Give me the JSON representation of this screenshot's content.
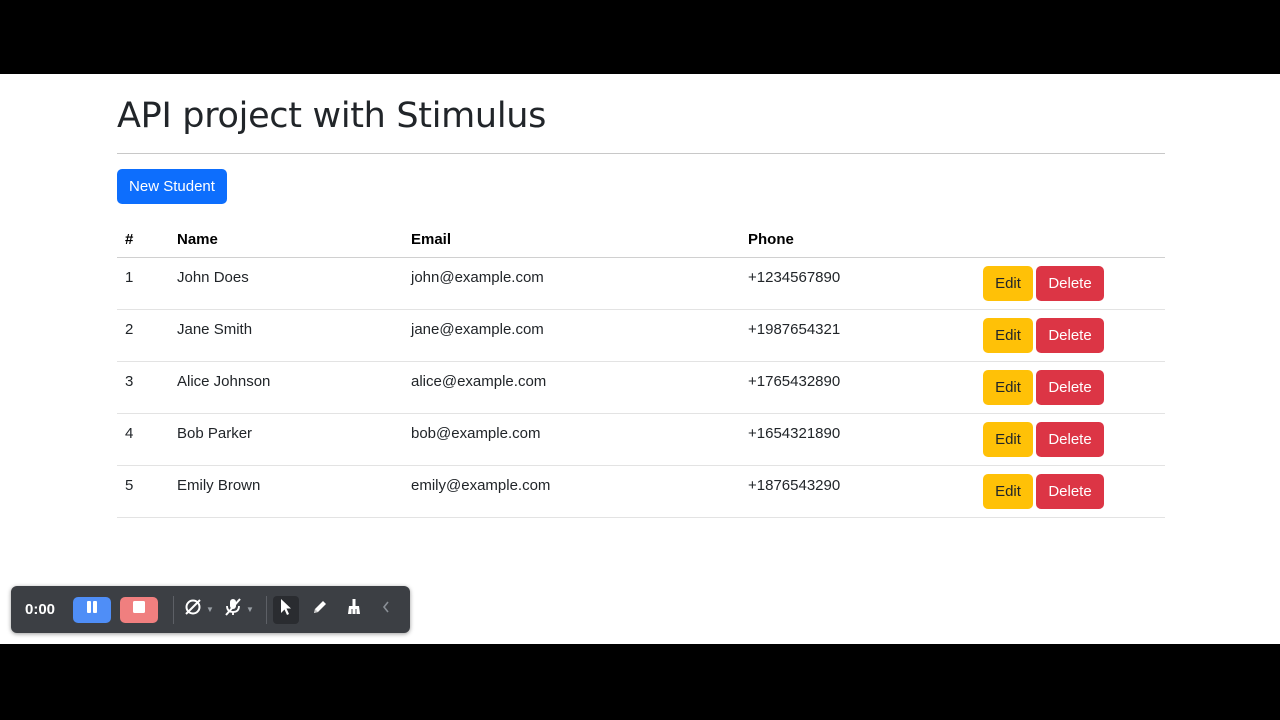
{
  "page": {
    "title": "API project with Stimulus",
    "new_student_label": "New Student"
  },
  "table": {
    "headers": [
      "#",
      "Name",
      "Email",
      "Phone",
      ""
    ],
    "edit_label": "Edit",
    "delete_label": "Delete",
    "rows": [
      {
        "id": "1",
        "name": "John Does",
        "email": "john@example.com",
        "phone": "+1234567890"
      },
      {
        "id": "2",
        "name": "Jane Smith",
        "email": "jane@example.com",
        "phone": "+1987654321"
      },
      {
        "id": "3",
        "name": "Alice Johnson",
        "email": "alice@example.com",
        "phone": "+1765432890"
      },
      {
        "id": "4",
        "name": "Bob Parker",
        "email": "bob@example.com",
        "phone": "+1654321890"
      },
      {
        "id": "5",
        "name": "Emily Brown",
        "email": "emily@example.com",
        "phone": "+1876543290"
      }
    ]
  },
  "recorder": {
    "time": "0:00",
    "icons": [
      "pause-icon",
      "stop-icon",
      "camera-off-icon",
      "mic-off-icon",
      "cursor-icon",
      "pen-icon",
      "eraser-icon",
      "collapse-icon"
    ]
  },
  "colors": {
    "primary": "#0d6efd",
    "warning": "#ffc107",
    "danger": "#dc3545",
    "recorder_bg": "#3c3f44"
  }
}
